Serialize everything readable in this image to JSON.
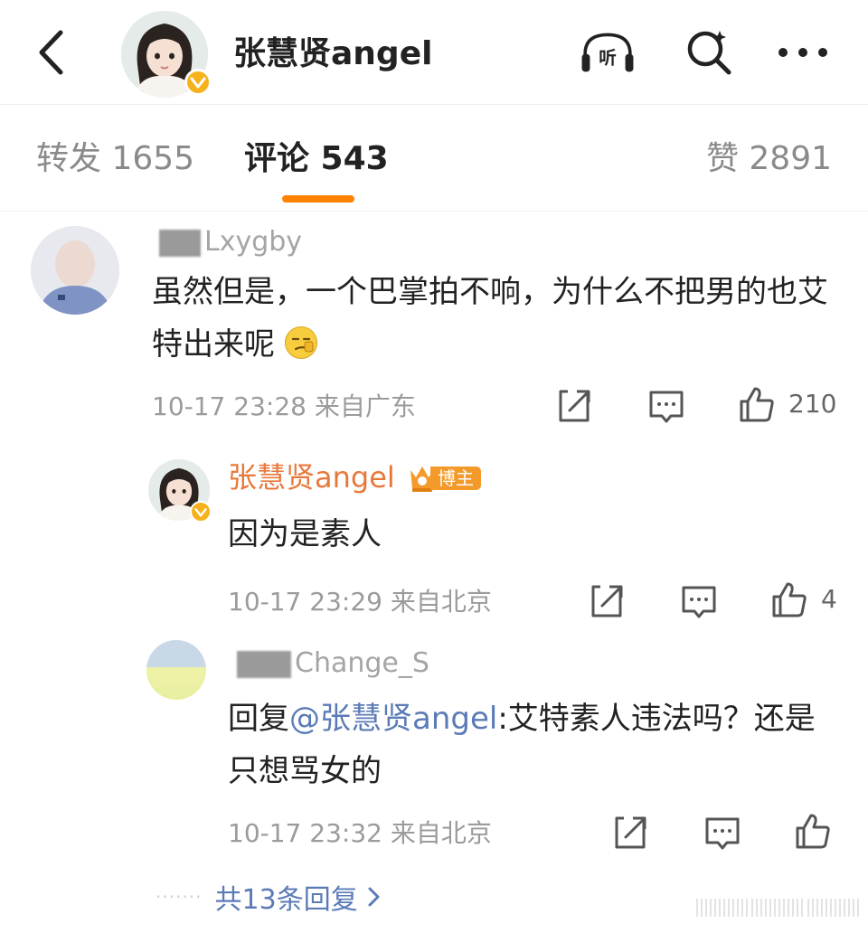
{
  "header": {
    "back_icon": "chevron-left-icon",
    "title": "张慧贤angel",
    "listen_label": "听",
    "search_icon": "search-icon",
    "more_icon": "more-horizontal-icon"
  },
  "tabs": [
    {
      "label": "转发 1655",
      "active": false
    },
    {
      "label": "评论 543",
      "active": true
    },
    {
      "label": "赞 2891",
      "active": false
    }
  ],
  "colors": {
    "accent": "#ff8200",
    "link": "#5b7bb6",
    "blogger_name": "#e8783a",
    "meta": "#9b9b9b"
  },
  "comments": [
    {
      "username": "Lxygby",
      "text": "虽然但是，一个巴掌拍不响，为什么不把男的也艾特出来呢",
      "meta": "10-17 23:28 来自广东",
      "likes": "210"
    },
    {
      "username": "张慧贤angel",
      "badge": "博主",
      "text": "因为是素人",
      "meta": "10-17 23:29 来自北京",
      "likes": "4"
    },
    {
      "username": "Change_S",
      "text_prefix": "回复",
      "mention": "@张慧贤angel",
      "text_suffix": ":艾特素人违法吗？还是只想骂女的",
      "meta": "10-17 23:32 来自北京",
      "likes": ""
    }
  ],
  "replies_link": {
    "dots": "·······",
    "label": "共13条回复"
  }
}
